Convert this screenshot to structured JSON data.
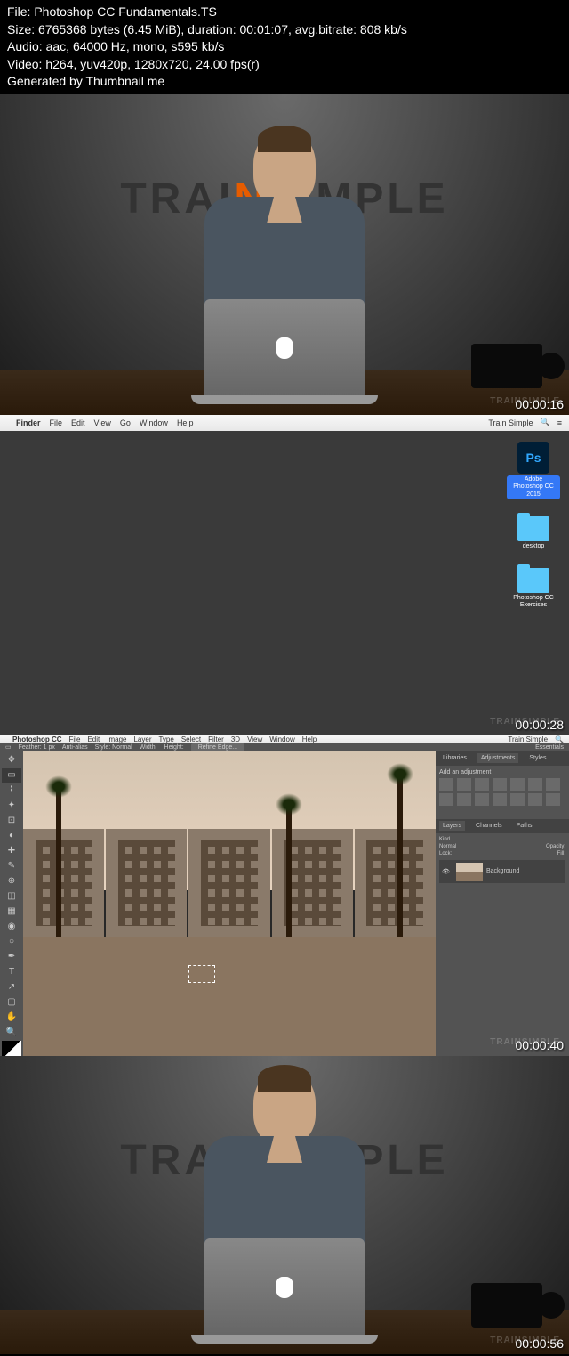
{
  "info": {
    "file_label": "File:",
    "file_value": "Photoshop CC Fundamentals.TS",
    "size_label": "Size:",
    "size_value": "6765368 bytes (6.45 MiB), duration: 00:01:07, avg.bitrate: 808 kb/s",
    "audio_label": "Audio:",
    "audio_value": "aac, 64000 Hz, mono, s595 kb/s",
    "video_label": "Video:",
    "video_value": "h264, yuv420p, 1280x720, 24.00 fps(r)",
    "generated": "Generated by Thumbnail me"
  },
  "brand": {
    "part1": "TRAI",
    "part2": "N",
    "part3": "SIMPLE"
  },
  "watermark": "TRAINSIMPLE",
  "timestamps": {
    "f1": "00:00:16",
    "f2": "00:00:28",
    "f3": "00:00:40",
    "f4": "00:00:56"
  },
  "mac": {
    "apple": "",
    "app": "Finder",
    "menus": [
      "File",
      "Edit",
      "View",
      "Go",
      "Window",
      "Help"
    ],
    "right": "Train Simple",
    "icons": {
      "ps": "Ps",
      "ps_label": "Adobe Photoshop CC 2015",
      "desktop_label": "desktop",
      "exercises_label": "Photoshop CC Exercises"
    }
  },
  "ps": {
    "app": "Photoshop CC",
    "menus": [
      "File",
      "Edit",
      "Image",
      "Layer",
      "Type",
      "Select",
      "Filter",
      "3D",
      "View",
      "Window",
      "Help"
    ],
    "right": "Train Simple",
    "options": {
      "feather": "Feather: 1 px",
      "antialias": "Anti-alias",
      "style": "Style: Normal",
      "width": "Width:",
      "height": "Height:",
      "refine": "Refine Edge..."
    },
    "workspace": "Essentials",
    "panels": {
      "tabs1": [
        "Libraries",
        "Adjustments",
        "Styles"
      ],
      "add_adj": "Add an adjustment",
      "tabs2": [
        "Layers",
        "Channels",
        "Paths"
      ],
      "kind": "Kind",
      "normal": "Normal",
      "opacity": "Opacity:",
      "lock": "Lock:",
      "fill": "Fill:",
      "layer_name": "Background"
    }
  }
}
